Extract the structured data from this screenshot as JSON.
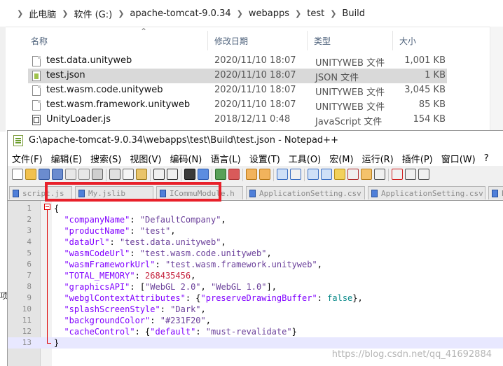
{
  "explorer": {
    "breadcrumb": [
      "此电脑",
      "软件 (G:)",
      "apache-tomcat-9.0.34",
      "webapps",
      "test",
      "Build"
    ],
    "columns": {
      "name": "名称",
      "date": "修改日期",
      "type": "类型",
      "size": "大小"
    },
    "files": [
      {
        "name": "test.data.unityweb",
        "date": "2020/11/10 18:07",
        "type": "UNITYWEB 文件",
        "size": "1,001 KB",
        "icon": "file-icon",
        "selected": false
      },
      {
        "name": "test.json",
        "date": "2020/11/10 18:07",
        "type": "JSON 文件",
        "size": "1 KB",
        "icon": "json-file-icon",
        "selected": true
      },
      {
        "name": "test.wasm.code.unityweb",
        "date": "2020/11/10 18:07",
        "type": "UNITYWEB 文件",
        "size": "3,045 KB",
        "icon": "file-icon",
        "selected": false
      },
      {
        "name": "test.wasm.framework.unityweb",
        "date": "2020/11/10 18:07",
        "type": "UNITYWEB 文件",
        "size": "85 KB",
        "icon": "file-icon",
        "selected": false
      },
      {
        "name": "UnityLoader.js",
        "date": "2018/12/11 0:48",
        "type": "JavaScript 文件",
        "size": "154 KB",
        "icon": "js-file-icon",
        "selected": false
      }
    ],
    "left_glyph": "项"
  },
  "notepad": {
    "title": "G:\\apache-tomcat-9.0.34\\webapps\\test\\Build\\test.json - Notepad++",
    "menu": [
      "文件(F)",
      "编辑(E)",
      "搜索(S)",
      "视图(V)",
      "编码(N)",
      "语言(L)",
      "设置(T)",
      "工具(O)",
      "宏(M)",
      "运行(R)",
      "插件(P)",
      "窗口(W)",
      "?"
    ],
    "tabs": [
      "script.js",
      "My.jslib",
      "ICommuModule.h",
      "ApplicationSetting.csv",
      "ApplicationSetting.csv",
      "Bookm"
    ],
    "lines": [
      {
        "n": "1",
        "tokens": [
          {
            "t": "{",
            "c": "br"
          }
        ]
      },
      {
        "n": "2",
        "tokens": [
          {
            "t": "  \"companyName\"",
            "c": "k"
          },
          {
            "t": ": ",
            "c": "p"
          },
          {
            "t": "\"DefaultCompany\"",
            "c": "s"
          },
          {
            "t": ",",
            "c": "p"
          }
        ]
      },
      {
        "n": "3",
        "tokens": [
          {
            "t": "  \"productName\"",
            "c": "k"
          },
          {
            "t": ": ",
            "c": "p"
          },
          {
            "t": "\"test\"",
            "c": "s"
          },
          {
            "t": ",",
            "c": "p"
          }
        ]
      },
      {
        "n": "4",
        "tokens": [
          {
            "t": "  \"dataUrl\"",
            "c": "k"
          },
          {
            "t": ": ",
            "c": "p"
          },
          {
            "t": "\"test.data.unityweb\"",
            "c": "s"
          },
          {
            "t": ",",
            "c": "p"
          }
        ]
      },
      {
        "n": "5",
        "tokens": [
          {
            "t": "  \"wasmCodeUrl\"",
            "c": "k"
          },
          {
            "t": ": ",
            "c": "p"
          },
          {
            "t": "\"test.wasm.code.unityweb\"",
            "c": "s"
          },
          {
            "t": ",",
            "c": "p"
          }
        ]
      },
      {
        "n": "6",
        "tokens": [
          {
            "t": "  \"wasmFrameworkUrl\"",
            "c": "k"
          },
          {
            "t": ": ",
            "c": "p"
          },
          {
            "t": "\"test.wasm.framework.unityweb\"",
            "c": "s"
          },
          {
            "t": ",",
            "c": "p"
          }
        ]
      },
      {
        "n": "7",
        "tokens": [
          {
            "t": "  \"TOTAL_MEMORY\"",
            "c": "k"
          },
          {
            "t": ": ",
            "c": "p"
          },
          {
            "t": "268435456",
            "c": "n"
          },
          {
            "t": ",",
            "c": "p"
          }
        ]
      },
      {
        "n": "8",
        "tokens": [
          {
            "t": "  \"graphicsAPI\"",
            "c": "k"
          },
          {
            "t": ": [",
            "c": "p"
          },
          {
            "t": "\"WebGL 2.0\"",
            "c": "s"
          },
          {
            "t": ", ",
            "c": "p"
          },
          {
            "t": "\"WebGL 1.0\"",
            "c": "s"
          },
          {
            "t": "],",
            "c": "p"
          }
        ]
      },
      {
        "n": "9",
        "tokens": [
          {
            "t": "  \"webglContextAttributes\"",
            "c": "k"
          },
          {
            "t": ": {",
            "c": "p"
          },
          {
            "t": "\"preserveDrawingBuffer\"",
            "c": "k"
          },
          {
            "t": ": ",
            "c": "p"
          },
          {
            "t": "false",
            "c": "v"
          },
          {
            "t": "},",
            "c": "p"
          }
        ]
      },
      {
        "n": "10",
        "tokens": [
          {
            "t": "  \"splashScreenStyle\"",
            "c": "k"
          },
          {
            "t": ": ",
            "c": "p"
          },
          {
            "t": "\"Dark\"",
            "c": "s"
          },
          {
            "t": ",",
            "c": "p"
          }
        ]
      },
      {
        "n": "11",
        "tokens": [
          {
            "t": "  \"backgroundColor\"",
            "c": "k"
          },
          {
            "t": ": ",
            "c": "p"
          },
          {
            "t": "\"#231F20\"",
            "c": "s"
          },
          {
            "t": ",",
            "c": "p"
          }
        ]
      },
      {
        "n": "12",
        "tokens": [
          {
            "t": "  \"cacheControl\"",
            "c": "k"
          },
          {
            "t": ": {",
            "c": "p"
          },
          {
            "t": "\"default\"",
            "c": "k"
          },
          {
            "t": ": ",
            "c": "p"
          },
          {
            "t": "\"must-revalidate\"",
            "c": "s"
          },
          {
            "t": "}",
            "c": "p"
          }
        ]
      },
      {
        "n": "13",
        "tokens": [
          {
            "t": "}",
            "c": "br"
          }
        ]
      }
    ],
    "current_line": "13",
    "highlight_line": "11"
  },
  "watermark": "https://blog.csdn.net/qq_41692884",
  "colors": {
    "annotation_red": "#e8202a",
    "current_line_bg": "#e8e8ff",
    "selected_row_bg": "#d9d9d9"
  }
}
